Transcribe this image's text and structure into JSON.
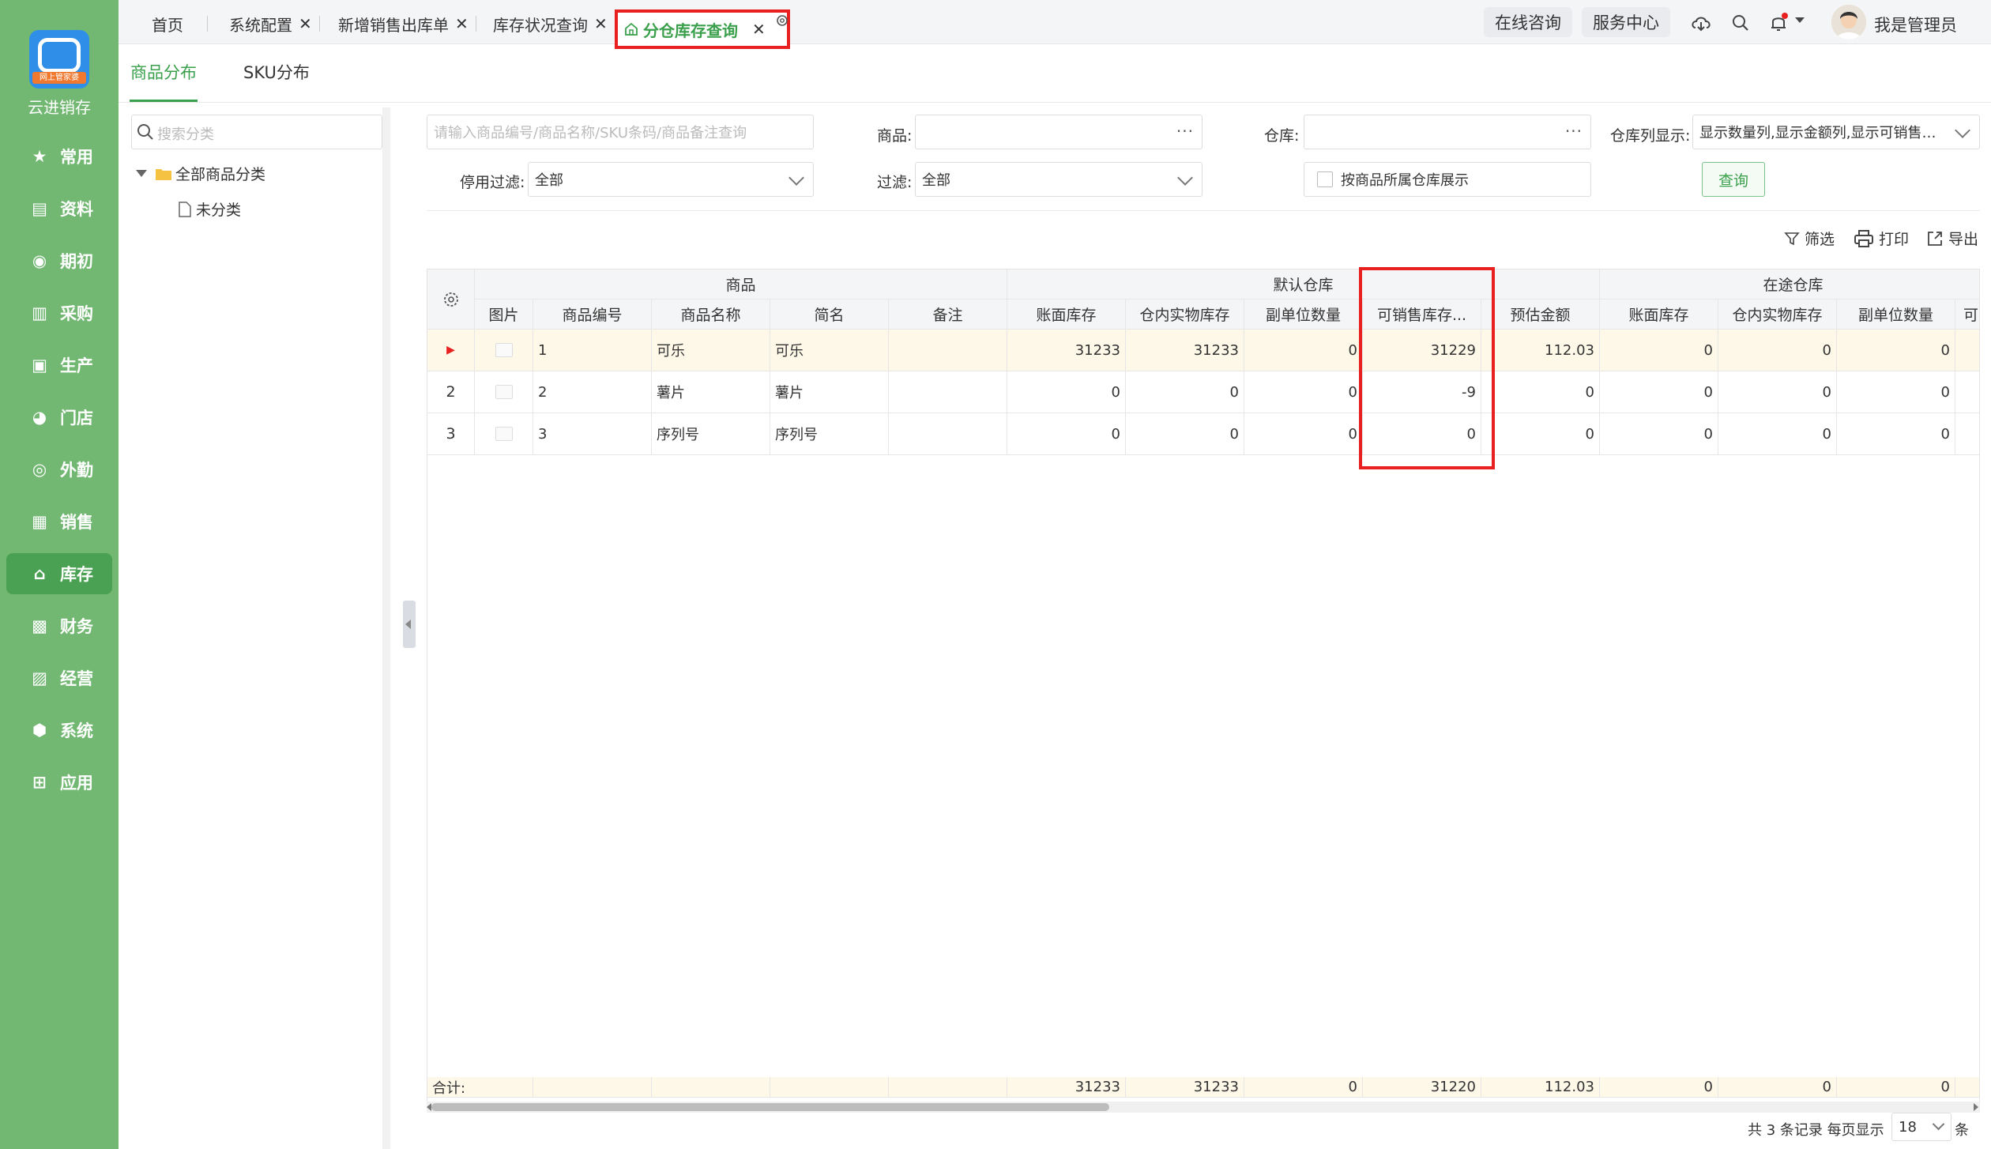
{
  "brand": {
    "name": "云进销存",
    "badge": "网上管家婆"
  },
  "sidebar": {
    "items": [
      {
        "label": "常用",
        "icon": "star-icon"
      },
      {
        "label": "资料",
        "icon": "profile-icon"
      },
      {
        "label": "期初",
        "icon": "target-icon"
      },
      {
        "label": "采购",
        "icon": "purchase-icon"
      },
      {
        "label": "生产",
        "icon": "production-icon"
      },
      {
        "label": "门店",
        "icon": "pie-icon"
      },
      {
        "label": "外勤",
        "icon": "field-icon"
      },
      {
        "label": "销售",
        "icon": "sales-chart-icon"
      },
      {
        "label": "库存",
        "icon": "warehouse-icon",
        "active": true
      },
      {
        "label": "财务",
        "icon": "wallet-icon"
      },
      {
        "label": "经营",
        "icon": "business-icon"
      },
      {
        "label": "系统",
        "icon": "hexagon-gear-icon"
      },
      {
        "label": "应用",
        "icon": "plus-square-icon"
      }
    ]
  },
  "tabs": [
    {
      "label": "首页",
      "closable": false
    },
    {
      "label": "系统配置",
      "closable": true
    },
    {
      "label": "新增销售出库单",
      "closable": true
    },
    {
      "label": "库存状况查询",
      "closable": true
    },
    {
      "label": "分仓库存查询",
      "closable": true,
      "active": true
    }
  ],
  "topbar": {
    "consult": "在线咨询",
    "service": "服务中心",
    "user": "我是管理员"
  },
  "subtabs": [
    "商品分布",
    "SKU分布"
  ],
  "tree": {
    "search_placeholder": "搜索分类",
    "root": "全部商品分类",
    "child": "未分类"
  },
  "filters": {
    "keyword_placeholder": "请输入商品编号/商品名称/SKU条码/商品备注查询",
    "product_label": "商品:",
    "warehouse_label": "仓库:",
    "column_display_label": "仓库列显示:",
    "column_display_value": "显示数量列,显示金额列,显示可销售库...",
    "disabled_filter_label": "停用过滤:",
    "disabled_filter_value": "全部",
    "filter_label": "过滤:",
    "filter_value": "全部",
    "by_warehouse_checkbox": "按商品所属仓库展示",
    "query_button": "查询"
  },
  "toolbar": {
    "filter": "筛选",
    "print": "打印",
    "export": "导出"
  },
  "table": {
    "group_headers": {
      "product": "商品",
      "default_wh": "默认仓库",
      "transit_wh": "在途仓库"
    },
    "columns": [
      "图片",
      "商品编号",
      "商品名称",
      "简名",
      "备注",
      "账面库存",
      "仓内实物库存",
      "副单位数量",
      "可销售库存...",
      "预估金额",
      "账面库存",
      "仓内实物库存",
      "副单位数量",
      "可"
    ],
    "rows": [
      {
        "idx": "▶",
        "code": "1",
        "name": "可乐",
        "short": "可乐",
        "note": "",
        "book": "31233",
        "phys": "31233",
        "sub": "0",
        "sale": "31229",
        "amount": "112.03",
        "t_book": "0",
        "t_phys": "0",
        "t_sub": "0"
      },
      {
        "idx": "2",
        "code": "2",
        "name": "薯片",
        "short": "薯片",
        "note": "",
        "book": "0",
        "phys": "0",
        "sub": "0",
        "sale": "-9",
        "amount": "0",
        "t_book": "0",
        "t_phys": "0",
        "t_sub": "0"
      },
      {
        "idx": "3",
        "code": "3",
        "name": "序列号",
        "short": "序列号",
        "note": "",
        "book": "0",
        "phys": "0",
        "sub": "0",
        "sale": "0",
        "amount": "0",
        "t_book": "0",
        "t_phys": "0",
        "t_sub": "0"
      }
    ],
    "totals": {
      "label": "合计:",
      "book": "31233",
      "phys": "31233",
      "sub": "0",
      "sale": "31220",
      "amount": "112.03",
      "t_book": "0",
      "t_phys": "0",
      "t_sub": "0"
    }
  },
  "pager": {
    "summary": "共 3 条记录 每页显示",
    "page_size": "18",
    "unit": "条"
  },
  "colors": {
    "sidebar": "#72b873",
    "accent": "#3aa04b",
    "highlight": "#e8201f"
  }
}
